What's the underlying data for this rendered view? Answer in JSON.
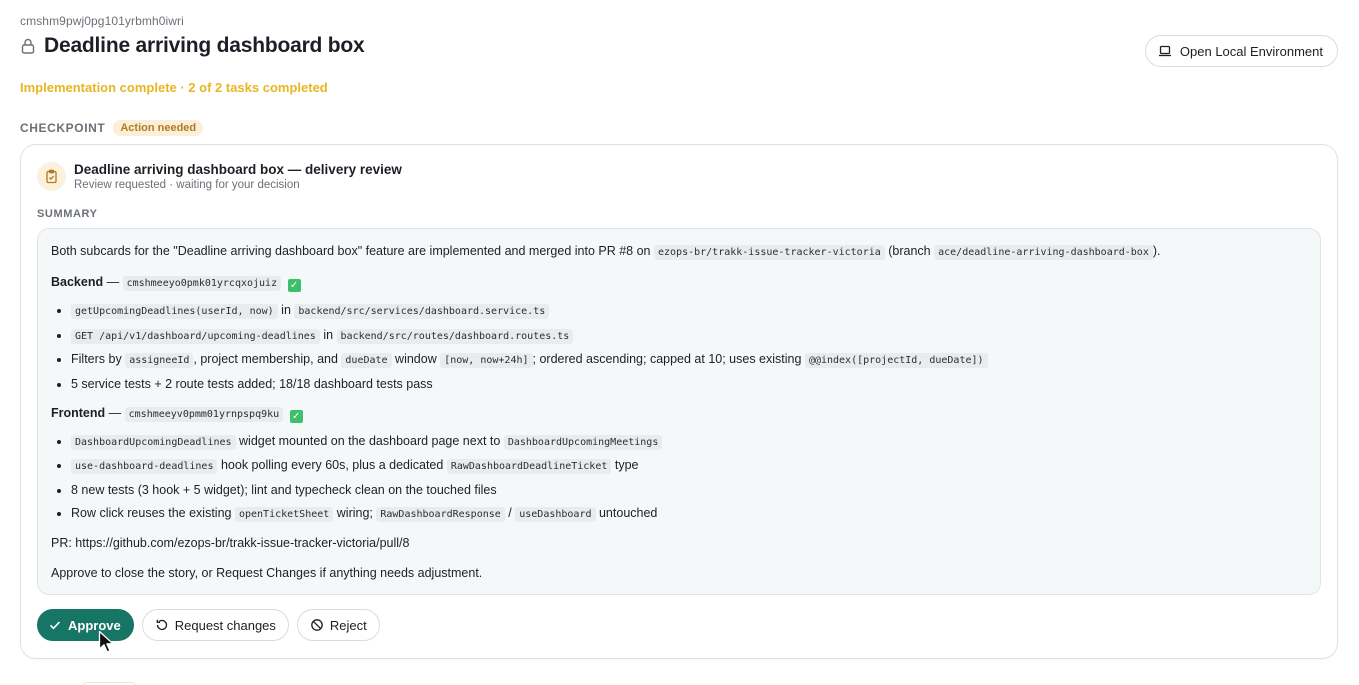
{
  "header": {
    "task_id": "cmshm9pwj0pg101yrbmh0iwri",
    "title": "Deadline arriving dashboard box",
    "env_button": "Open Local Environment"
  },
  "status": "Implementation complete · 2 of 2 tasks completed",
  "checkpoint": {
    "label": "CHECKPOINT",
    "badge": "Action needed"
  },
  "card": {
    "title": "Deadline arriving dashboard box — delivery review",
    "subtitle": "Review requested · waiting for your decision",
    "summary_label": "SUMMARY",
    "intro": {
      "t1": "Both subcards for the \"Deadline arriving dashboard box\" feature are implemented and merged into PR #8 on",
      "repo": "ezops-br/trakk-issue-tracker-victoria",
      "t2": "(branch",
      "branch": "ace/deadline-arriving-dashboard-box",
      "t3": ")."
    },
    "backend": {
      "label": "Backend",
      "dash": "—",
      "id": "cmshmeeyo0pmk01yrcqxojuiz",
      "check": "✓",
      "items": [
        {
          "c1": "getUpcomingDeadlines(userId, now)",
          "t1": "in",
          "c2": "backend/src/services/dashboard.service.ts"
        },
        {
          "c1": "GET /api/v1/dashboard/upcoming-deadlines",
          "t1": "in",
          "c2": "backend/src/routes/dashboard.routes.ts"
        },
        {
          "t1": "Filters by",
          "c1": "assigneeId",
          "t2": ", project membership, and",
          "c2": "dueDate",
          "t3": "window",
          "c3": "[now, now+24h]",
          "t4": "; ordered ascending; capped at 10; uses existing",
          "c4": "@@index([projectId, dueDate])"
        },
        {
          "t1": "5 service tests + 2 route tests added; 18/18 dashboard tests pass"
        }
      ]
    },
    "frontend": {
      "label": "Frontend",
      "dash": "—",
      "id": "cmshmeeyv0pmm01yrnpspq9ku",
      "check": "✓",
      "items": [
        {
          "c1": "DashboardUpcomingDeadlines",
          "t1": "widget mounted on the dashboard page next to",
          "c2": "DashboardUpcomingMeetings"
        },
        {
          "c1": "use-dashboard-deadlines",
          "t1": "hook polling every 60s, plus a dedicated",
          "c2": "RawDashboardDeadlineTicket",
          "t2": "type"
        },
        {
          "t1": "8 new tests (3 hook + 5 widget); lint and typecheck clean on the touched files"
        },
        {
          "t1": "Row click reuses the existing",
          "c1": "openTicketSheet",
          "t2": "wiring;",
          "c2": "RawDashboardResponse",
          "t3": "/",
          "c3": "useDashboard",
          "t4": "untouched"
        }
      ]
    },
    "pr_line": "PR: https://github.com/ezops-br/trakk-issue-tracker-victoria/pull/8",
    "closing": "Approve to close the story, or Request Changes if anything needs adjustment."
  },
  "actions": {
    "approve": "Approve",
    "request_changes": "Request changes",
    "reject": "Reject"
  },
  "colors": {
    "accent": "#177565",
    "status": "#e8b623",
    "badge_text": "#b7791f",
    "badge_bg": "#faefd9"
  }
}
